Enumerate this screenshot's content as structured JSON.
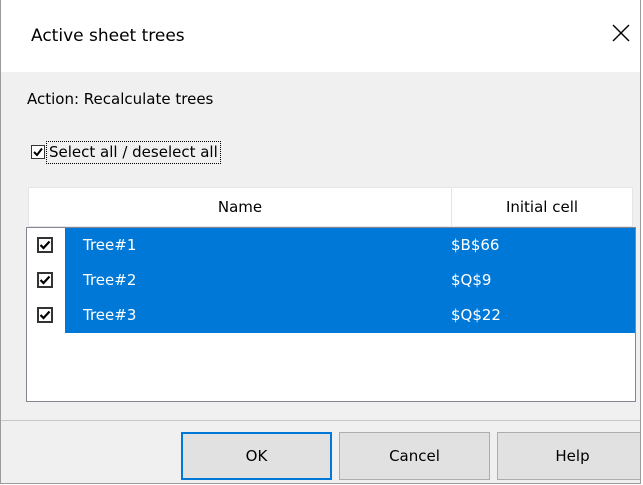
{
  "window": {
    "title": "Active sheet trees"
  },
  "action": {
    "label": "Action: Recalculate trees"
  },
  "select_all": {
    "label": "Select all / deselect all",
    "checked": true
  },
  "table": {
    "columns": [
      "Name",
      "Initial cell"
    ],
    "rows": [
      {
        "name": "Tree#1",
        "initial_cell": "$B$66",
        "checked": true,
        "selected": true
      },
      {
        "name": "Tree#2",
        "initial_cell": "$Q$9",
        "checked": true,
        "selected": true
      },
      {
        "name": "Tree#3",
        "initial_cell": "$Q$22",
        "checked": true,
        "selected": true
      }
    ]
  },
  "buttons": {
    "ok": "OK",
    "cancel": "Cancel",
    "help": "Help"
  },
  "colors": {
    "selection": "#0078d7",
    "dialog_bg": "#f0f0f0",
    "titlebar_bg": "#ffffff",
    "button_bg": "#e1e1e1"
  },
  "icons": {
    "close": "close-icon",
    "check": "checkmark-icon"
  }
}
